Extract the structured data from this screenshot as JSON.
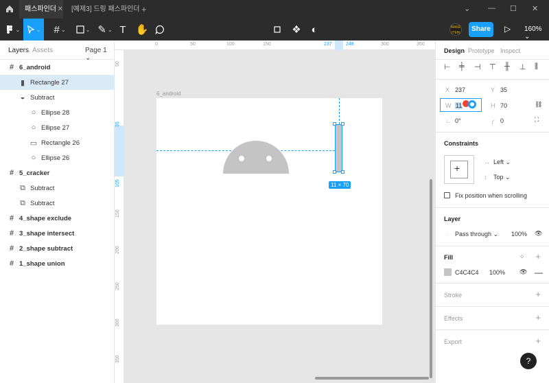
{
  "tabs": {
    "active": "패스파인더",
    "inactive": "[예제3] 드링 패스파인더"
  },
  "toolbar": {
    "share_label": "Share",
    "zoom_label": "160%",
    "avatar_text": "MAKE ITEM"
  },
  "left_panel": {
    "tab_layers": "Layers",
    "tab_assets": "Assets",
    "page_selector": "Page 1",
    "layers": [
      {
        "label": "6_android",
        "icon": "#",
        "kind": "frame",
        "indent": 0
      },
      {
        "label": "Rectangle 27",
        "icon": "▮",
        "kind": "rect",
        "indent": 1,
        "selected": true
      },
      {
        "label": "Subtract",
        "icon": "◒",
        "kind": "boolean",
        "indent": 1
      },
      {
        "label": "Ellipse 28",
        "icon": "○",
        "kind": "ellipse",
        "indent": 2
      },
      {
        "label": "Ellipse 27",
        "icon": "○",
        "kind": "ellipse",
        "indent": 2
      },
      {
        "label": "Rectangle 26",
        "icon": "▭",
        "kind": "rect",
        "indent": 2
      },
      {
        "label": "Ellipse 26",
        "icon": "○",
        "kind": "ellipse",
        "indent": 2
      },
      {
        "label": "5_cracker",
        "icon": "#",
        "kind": "frame",
        "indent": 0
      },
      {
        "label": "Subtract",
        "icon": "⧉",
        "kind": "boolean",
        "indent": 1
      },
      {
        "label": "Subtract",
        "icon": "⧉",
        "kind": "boolean",
        "indent": 1
      },
      {
        "label": "4_shape exclude",
        "icon": "#",
        "kind": "frame",
        "indent": 0
      },
      {
        "label": "3_shape intersect",
        "icon": "#",
        "kind": "frame",
        "indent": 0
      },
      {
        "label": "2_shape subtract",
        "icon": "#",
        "kind": "frame",
        "indent": 0
      },
      {
        "label": "1_shape union",
        "icon": "#",
        "kind": "frame",
        "indent": 0
      }
    ]
  },
  "ruler_top": {
    "ticks": [
      "0",
      "50",
      "100",
      "150",
      "237",
      "248",
      "300",
      "350"
    ]
  },
  "ruler_left": {
    "ticks": [
      "50",
      "35",
      "105",
      "150",
      "200",
      "250",
      "300",
      "350"
    ]
  },
  "canvas": {
    "frame_label": "6_android",
    "dimension_label": "11 × 70"
  },
  "right_panel": {
    "tab_design": "Design",
    "tab_prototype": "Prototype",
    "tab_inspect": "Inspect",
    "x_label": "X",
    "x_value": "237",
    "y_label": "Y",
    "y_value": "35",
    "w_label": "W",
    "w_value": "11",
    "h_label": "H",
    "h_value": "70",
    "rotation_value": "0°",
    "radius_value": "0",
    "constraints_title": "Constraints",
    "constraint_h": "Left",
    "constraint_v": "Top",
    "fix_position_label": "Fix position when scrolling",
    "layer_title": "Layer",
    "blend_mode": "Pass through",
    "layer_opacity": "100%",
    "fill_title": "Fill",
    "fill_hex": "C4C4C4",
    "fill_opacity": "100%",
    "stroke_title": "Stroke",
    "effects_title": "Effects",
    "export_title": "Export",
    "help_label": "?"
  },
  "colors": {
    "accent": "#18a0fb",
    "fill": "#c4c4c4",
    "chrome": "#2c2c2c"
  }
}
